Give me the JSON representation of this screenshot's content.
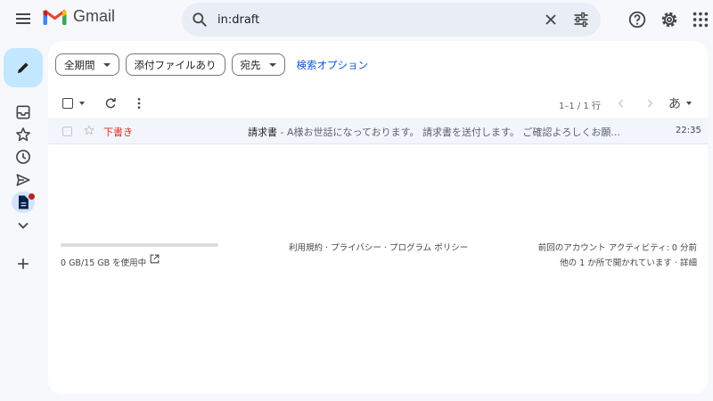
{
  "app": {
    "name": "Gmail",
    "accent": "#0b57d0",
    "compose_bg": "#c2e7ff",
    "draft_color": "#d93025"
  },
  "header": {
    "search_value": "in:draft",
    "icons": [
      "menu-icon",
      "gmail-logo",
      "search-icon",
      "close-icon",
      "tune-icon",
      "help-icon",
      "gear-icon",
      "apps-grid-icon"
    ]
  },
  "rail": {
    "icons": [
      "pencil-icon",
      "inbox-icon",
      "star-icon",
      "clock-icon",
      "send-icon",
      "draft-file-icon",
      "chevron-down-icon",
      "plus-icon"
    ]
  },
  "filters": {
    "chip_period": "全期間",
    "chip_attachment": "添付ファイルあり",
    "chip_to": "宛先",
    "advanced_link": "検索オプション"
  },
  "toolbar": {
    "pager": "1–1 / 1 行",
    "lang": "あ"
  },
  "emails": [
    {
      "sender": "下書き",
      "subject": "請求書",
      "snippet": " - A様お世話になっております。 請求書を送付します。 ご確認よろしくお願...",
      "time": "22:35"
    }
  ],
  "footer": {
    "storage": "0 GB/15 GB を使用中",
    "storage_used_fraction": 0,
    "terms": "利用規約",
    "sep1": " · ",
    "privacy": "プライバシー",
    "sep2": " · ",
    "program": "プログラム ポリシー",
    "last_activity": "前回のアカウント アクティビティ: 0 分前",
    "other_location": "他の 1 か所で開かれています",
    "sep3": " · ",
    "details": "詳細"
  }
}
